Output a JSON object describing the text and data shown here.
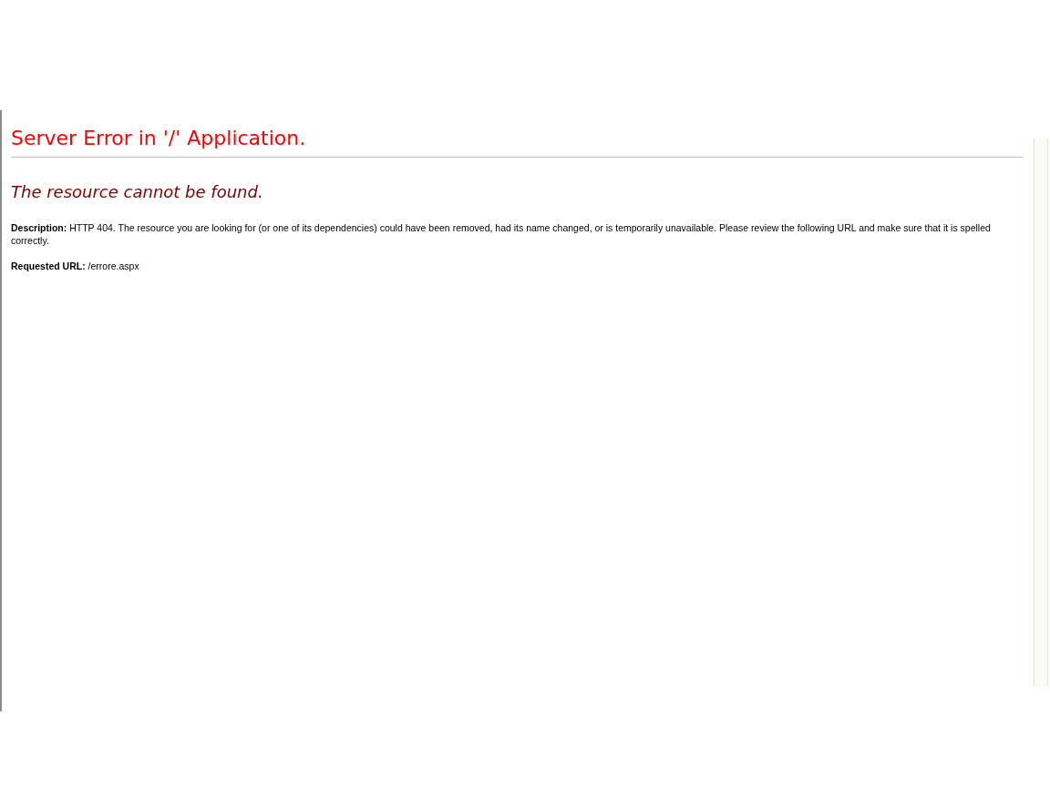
{
  "page": {
    "title": "Server Error in '/' Application.",
    "subtitle": "The resource cannot be found.",
    "description": "**Description:** HTTP 404. The resource you are looking for (or one of its dependencies) could have been removed, had its name changed, or is temporarily unavailable. Please review the following URL and make sure that it is spelled correctly.",
    "requested_url": "**Requested URL:** /errore.aspx"
  }
}
